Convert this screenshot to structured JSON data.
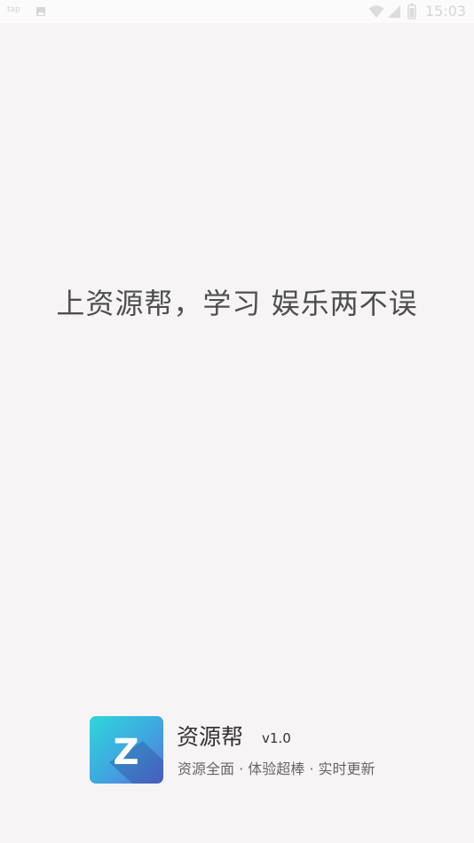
{
  "status_bar": {
    "left_text": "tap",
    "notification_icon": "image-icon",
    "time": "15:03",
    "icons": [
      "wifi-icon",
      "signal-icon",
      "battery-icon"
    ]
  },
  "splash": {
    "slogan": "上资源帮，学习 娱乐两不误"
  },
  "app": {
    "logo_letter": "Z",
    "name": "资源帮",
    "version": "v1.0",
    "tagline": "资源全面 · 体验超棒 · 实时更新",
    "logo_gradient_colors": [
      "#2fd5dc",
      "#5b6fdc"
    ]
  }
}
